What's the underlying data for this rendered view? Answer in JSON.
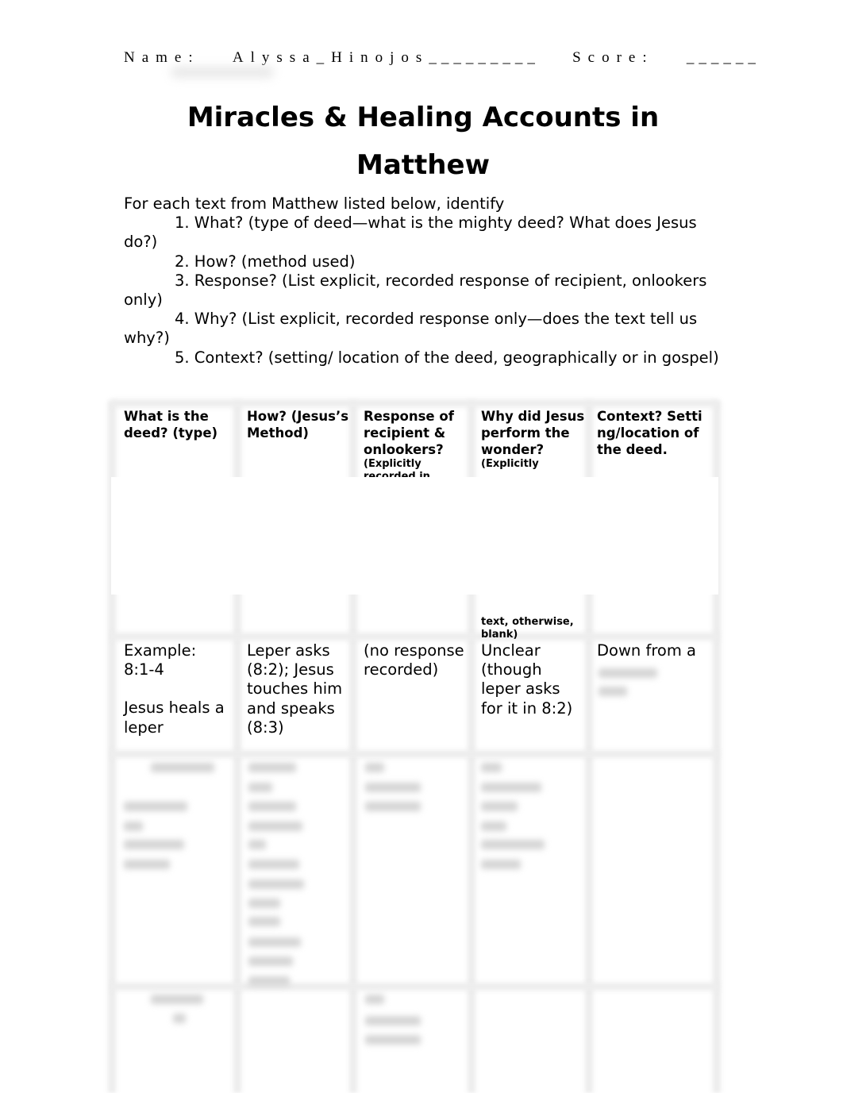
{
  "header": {
    "name_label": "Name:",
    "name_value": "Alyssa_Hinojos",
    "name_blank": "_________",
    "score_label": "Score:",
    "score_blank": "______"
  },
  "title": {
    "line1": "Miracles & Healing Accounts in",
    "line2": "Matthew"
  },
  "instructions": {
    "lead": "For each text from Matthew listed below, identify",
    "items": [
      "1. What? (type of deed—what is the mighty deed? What does Jesus do?)",
      "2. How? (method used)",
      "3. Response? (List explicit, recorded response of recipient, onlookers only)",
      "4. Why? (List explicit, recorded response only—does the text tell us why?)",
      "5. Context? (setting/ location of the deed, geographically or in gospel)"
    ]
  },
  "table": {
    "headers": [
      {
        "title": "What is the deed? (type)",
        "note": ""
      },
      {
        "title": "How? (Jesus’s Method)",
        "note": ""
      },
      {
        "title": "Response of recipient & onlookers?",
        "note": "(Explicitly recorded in"
      },
      {
        "title": "Why did Jesus perform the wonder?",
        "note": "(Explicitly"
      },
      {
        "title": "Context? Setting/location of the deed.",
        "note": ""
      }
    ],
    "header_continuation": {
      "why_note_end": "text, otherwise, blank)"
    },
    "example_row": {
      "deed_ref": "Example: 8:1-4",
      "deed_desc": "Jesus heals a leper",
      "how": "Leper asks (8:2); Jesus touches him and speaks (8:3)",
      "response": "(no response recorded)",
      "why": "Unclear (though leper asks for it in 8:2)",
      "context": "Down from a"
    }
  }
}
